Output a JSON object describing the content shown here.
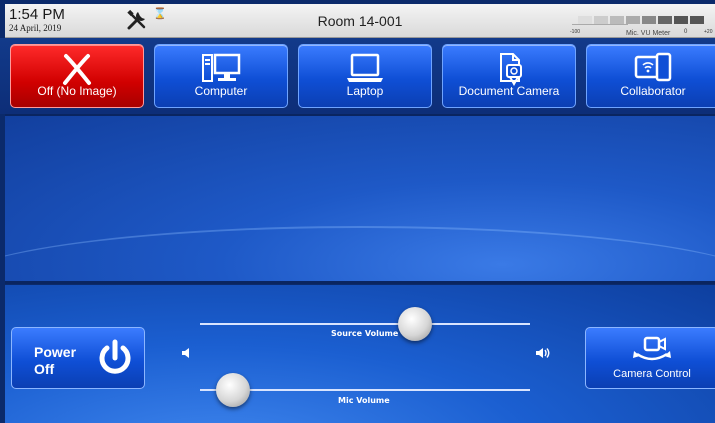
{
  "status": {
    "time": "1:54 PM",
    "date": "24 April, 2019",
    "room": "Room 14-001",
    "hourglass_glyph": "⌛"
  },
  "vu_meter": {
    "label": "Mic. VU Meter",
    "min": "-100",
    "mid": "0",
    "max": "+20"
  },
  "sources": [
    {
      "label": "Off (No Image)",
      "icon": "x-off-icon",
      "selected": true,
      "color": "#d10000"
    },
    {
      "label": "Computer",
      "icon": "computer-icon",
      "selected": false
    },
    {
      "label": "Laptop",
      "icon": "laptop-icon",
      "selected": false
    },
    {
      "label": "Document Camera",
      "icon": "document-camera-icon",
      "selected": false
    },
    {
      "label": "Collaborator",
      "icon": "collaborator-icon",
      "selected": false
    }
  ],
  "controls": {
    "power_line1": "Power",
    "power_line2": "Off",
    "camera_label": "Camera Control",
    "source_volume_label": "Source Volume",
    "mic_volume_label": "Mic Volume",
    "source_volume_level": 0.65,
    "mic_volume_level": 0.1
  },
  "colors": {
    "accent_blue": "#0f4fd6",
    "off_red": "#d10000"
  }
}
